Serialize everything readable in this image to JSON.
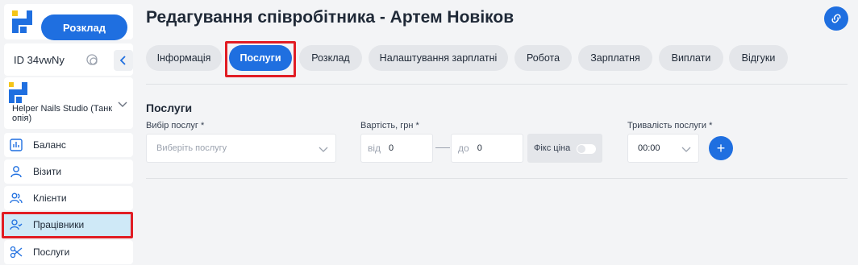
{
  "sidebar": {
    "schedule_button": "Розклад",
    "id_label": "ID 34vwNy",
    "studio_name": "Helper Nails Studio (Танк опія)",
    "items": [
      {
        "label": "Баланс",
        "icon": "chart-icon"
      },
      {
        "label": "Візити",
        "icon": "person-icon"
      },
      {
        "label": "Клієнти",
        "icon": "people-icon"
      },
      {
        "label": "Працівники",
        "icon": "user-check-icon"
      },
      {
        "label": "Послуги",
        "icon": "scissors-icon"
      }
    ]
  },
  "header": {
    "title": "Редагування співробітника - Артем Новіков"
  },
  "tabs": [
    {
      "label": "Інформація"
    },
    {
      "label": "Послуги"
    },
    {
      "label": "Розклад"
    },
    {
      "label": "Налаштування зарплатні"
    },
    {
      "label": "Робота"
    },
    {
      "label": "Зарплатня"
    },
    {
      "label": "Виплати"
    },
    {
      "label": "Відгуки"
    }
  ],
  "services": {
    "section_title": "Послуги",
    "service_select_label": "Вибір послуг",
    "service_select_placeholder": "Виберіть послугу",
    "price_label": "Вартість, грн",
    "price_from_prefix": "від",
    "price_from_value": "0",
    "price_to_prefix": "до",
    "price_to_value": "0",
    "fixed_price_label": "Фікс ціна",
    "duration_label": "Тривалість послуги",
    "duration_value": "00:00",
    "required_mark": "*",
    "add_button": "+"
  },
  "colors": {
    "accent": "#1f6fe0",
    "highlight": "#e11d24",
    "active_nav": "#cfe9f7"
  }
}
